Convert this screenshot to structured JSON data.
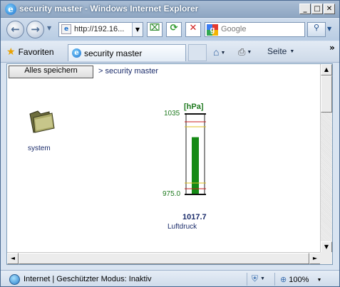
{
  "window": {
    "title": "security master - Windows Internet Explorer",
    "minimize": "_",
    "maximize": "□",
    "close": "✕"
  },
  "nav": {
    "back_icon": "back-arrow-icon",
    "forward_icon": "forward-arrow-icon",
    "address": "http://192.16...",
    "search_placeholder": "Google",
    "search_engine_letter": "g"
  },
  "tabs": {
    "favorites_label": "Favoriten",
    "active_tab_label": "security master",
    "page_menu_label": "Seite"
  },
  "page": {
    "save_all_label": "Alles speichern",
    "breadcrumb": "> security master",
    "folder_label": "system"
  },
  "gauge": {
    "unit": "[hPa]",
    "max_label": "1035",
    "min_label": "975.0",
    "value_label": "1017.7",
    "name_label": "Luftdruck",
    "min": 975.0,
    "max": 1035,
    "value": 1017.7,
    "fill_color": "#158a15",
    "warn_color": "#e0c020",
    "alarm_color": "#c82020"
  },
  "status": {
    "zone_text": "Internet | Geschützter Modus: Inaktiv",
    "zoom_text": "100%"
  }
}
